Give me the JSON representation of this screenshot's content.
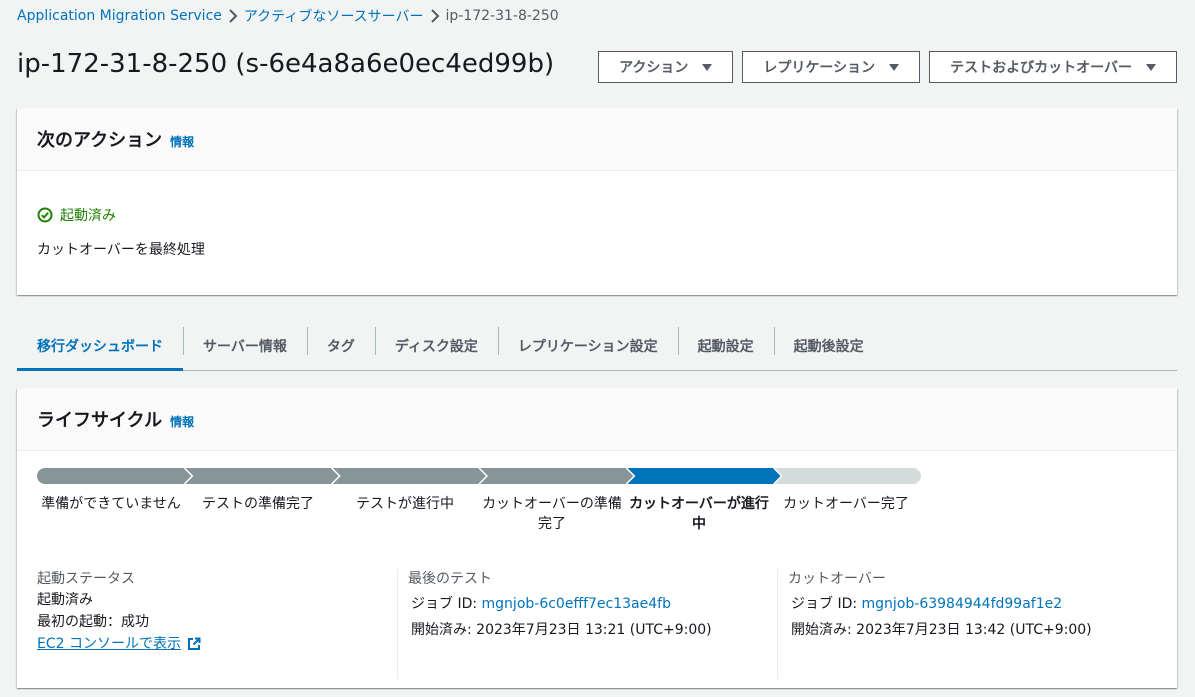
{
  "breadcrumb": {
    "items": [
      "Application Migration Service",
      "アクティブなソースサーバー",
      "ip-172-31-8-250"
    ]
  },
  "page": {
    "title": "ip-172-31-8-250 (s-6e4a8a6e0ec4ed99b)"
  },
  "actions": {
    "action_label": "アクション",
    "replication_label": "レプリケーション",
    "test_cutover_label": "テストおよびカットオーバー"
  },
  "next_actions": {
    "title": "次のアクション",
    "info": "情報",
    "status": "起動済み",
    "text": "カットオーバーを最終処理"
  },
  "tabs": [
    {
      "label": "移行ダッシュボード",
      "active": true
    },
    {
      "label": "サーバー情報"
    },
    {
      "label": "タグ"
    },
    {
      "label": "ディスク設定"
    },
    {
      "label": "レプリケーション設定"
    },
    {
      "label": "起動設定"
    },
    {
      "label": "起動後設定"
    }
  ],
  "lifecycle": {
    "title": "ライフサイクル",
    "info": "情報",
    "steps": [
      {
        "label": "準備ができていません",
        "state": "done"
      },
      {
        "label": "テストの準備完了",
        "state": "done"
      },
      {
        "label": "テストが進行中",
        "state": "done"
      },
      {
        "label": "カットオーバーの準備完了",
        "state": "done"
      },
      {
        "label": "カットオーバーが進行中",
        "state": "current"
      },
      {
        "label": "カットオーバー完了",
        "state": "pending"
      }
    ],
    "colors": {
      "done": "#879596",
      "current": "#0073bb",
      "pending": "#d5dbdb"
    },
    "launch_status": {
      "title": "起動ステータス",
      "status": "起動済み",
      "first_launch": "最初の起動：成功",
      "link": "EC2 コンソールで表示"
    },
    "last_test": {
      "title": "最後のテスト",
      "job_label": "ジョブ ID:",
      "job_id": "mgnjob-6c0efff7ec13ae4fb",
      "started_label": "開始済み:",
      "started": "2023年7月23日 13:21 (UTC+9:00)"
    },
    "cutover": {
      "title": "カットオーバー",
      "job_label": "ジョブ ID:",
      "job_id": "mgnjob-63984944fd99af1e2",
      "started_label": "開始済み:",
      "started": "2023年7月23日 13:42 (UTC+9:00)"
    }
  }
}
